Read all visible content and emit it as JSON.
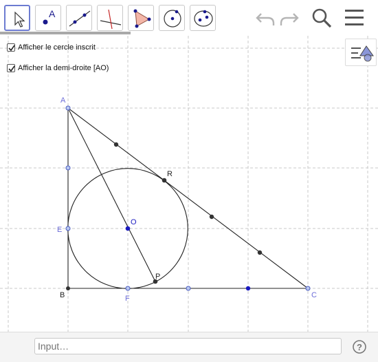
{
  "toolbar": {
    "tools": [
      {
        "name": "move-tool",
        "active": true
      },
      {
        "name": "point-tool",
        "label": "A"
      },
      {
        "name": "line-tool"
      },
      {
        "name": "perpendicular-line-tool"
      },
      {
        "name": "polygon-tool"
      },
      {
        "name": "circle-center-point-tool"
      },
      {
        "name": "conic-tool"
      }
    ],
    "undo_icon": "undo-icon",
    "redo_icon": "redo-icon",
    "search_icon": "search-icon",
    "menu_icon": "menu-icon"
  },
  "checkboxes": [
    {
      "label": "Afficher le cercle inscrit",
      "checked": true
    },
    {
      "label": "Afficher la demi-droite [AO)",
      "checked": true
    }
  ],
  "style_bar_icon": "style-bar-icon",
  "graphics": {
    "points": {
      "A": {
        "label": "A",
        "color": "#6c6cd8"
      },
      "B": {
        "label": "B",
        "color": "#222222"
      },
      "C": {
        "label": "C",
        "color": "#6c6cd8"
      },
      "E": {
        "label": "E",
        "color": "#6c6cd8"
      },
      "F": {
        "label": "F",
        "color": "#6c6cd8"
      },
      "O": {
        "label": "O",
        "color": "#1a1ac0"
      },
      "R": {
        "label": "R",
        "color": "#222222"
      },
      "P": {
        "label": "P",
        "color": "#222222"
      }
    }
  },
  "input_bar": {
    "placeholder": "Input…"
  },
  "help_icon": "help-icon",
  "colors": {
    "accent": "#6c7bd1",
    "grid": "#c8c8c8",
    "point_blue": "#6c6cd8"
  }
}
